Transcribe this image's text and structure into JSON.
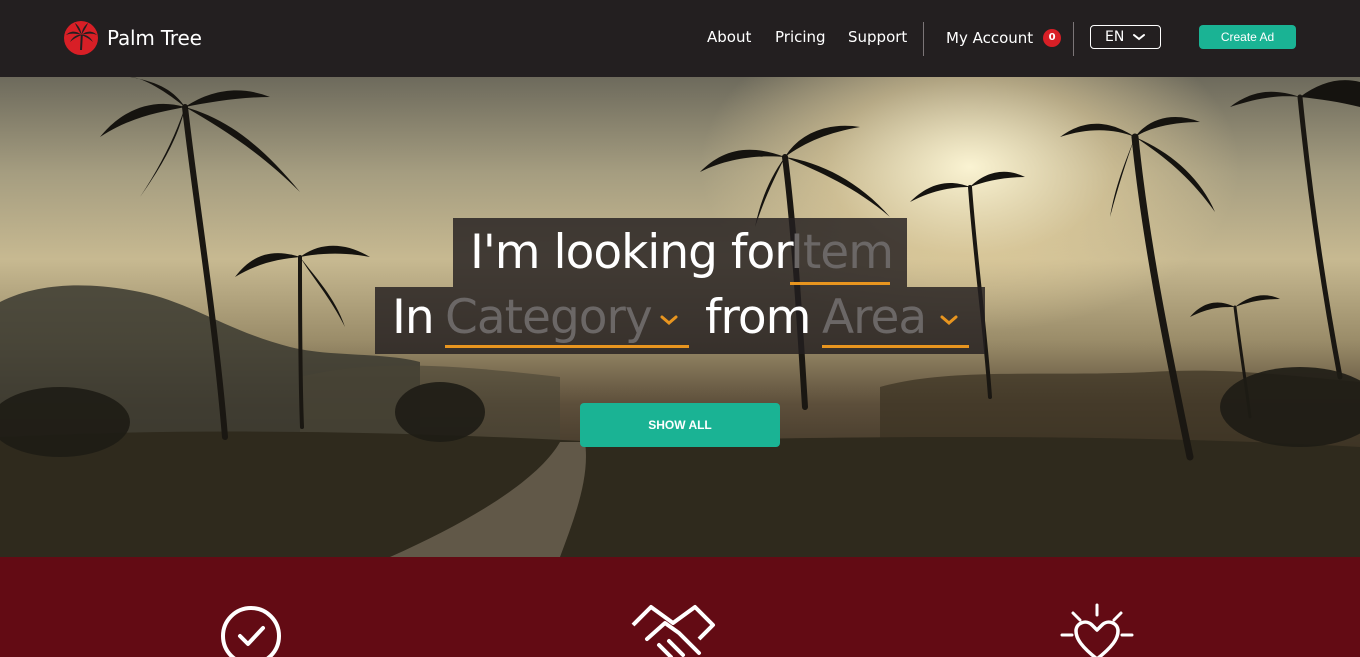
{
  "brand": {
    "name": "Palm Tree",
    "logo_icon": "palm-tree-logo-icon",
    "accent": "#1ab394",
    "brand_red": "#d81f26",
    "underline": "#e8951f"
  },
  "nav": {
    "links": [
      {
        "label": "About"
      },
      {
        "label": "Pricing"
      },
      {
        "label": "Support"
      }
    ],
    "account": {
      "label": "My Account",
      "badge": "0"
    },
    "language": {
      "selected": "EN",
      "icon": "chevron-down-icon"
    },
    "create_ad": "Create Ad"
  },
  "hero": {
    "phrase_start": "I'm looking for",
    "phrase_in": "In",
    "phrase_from": "from",
    "item_placeholder": "Item",
    "category_placeholder": "Category",
    "area_placeholder": "Area",
    "dropdown_icon": "chevron-down-icon",
    "show_all": "SHOW ALL"
  },
  "features": {
    "background": "#630b14",
    "icons": [
      "check-circle-icon",
      "handshake-icon",
      "glowing-heart-icon"
    ]
  }
}
